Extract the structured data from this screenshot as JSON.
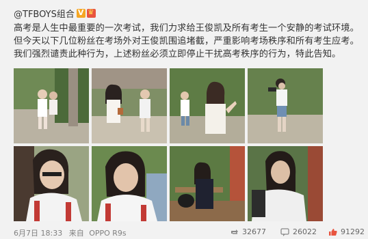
{
  "post": {
    "author": "@TFBOYS组合",
    "text": "高考是人生中最重要的一次考试，我们力求给王俊凯及所有考生一个安静的考试环境。但今天以下几位粉丝在考场外对王俊凯围追堵截，严重影响考场秩序和所有考生应考。我们强烈谴责此种行为，上述粉丝必须立即停止干扰高考秩序的行为，特此告知。",
    "date": "6月7日 18:33",
    "source_prefix": "来自",
    "source": "OPPO R9s"
  },
  "stats": {
    "reposts": "32677",
    "comments": "26022",
    "likes": "91292"
  },
  "icons": {
    "verified": "verified-v-icon",
    "member": "crown-badge-icon",
    "repost": "repost-icon",
    "comment": "comment-icon",
    "like": "like-thumb-icon"
  },
  "colors": {
    "accent_red": "#e8543f",
    "verified_orange": "#f5a623",
    "text": "#333333",
    "muted": "#808080"
  }
}
